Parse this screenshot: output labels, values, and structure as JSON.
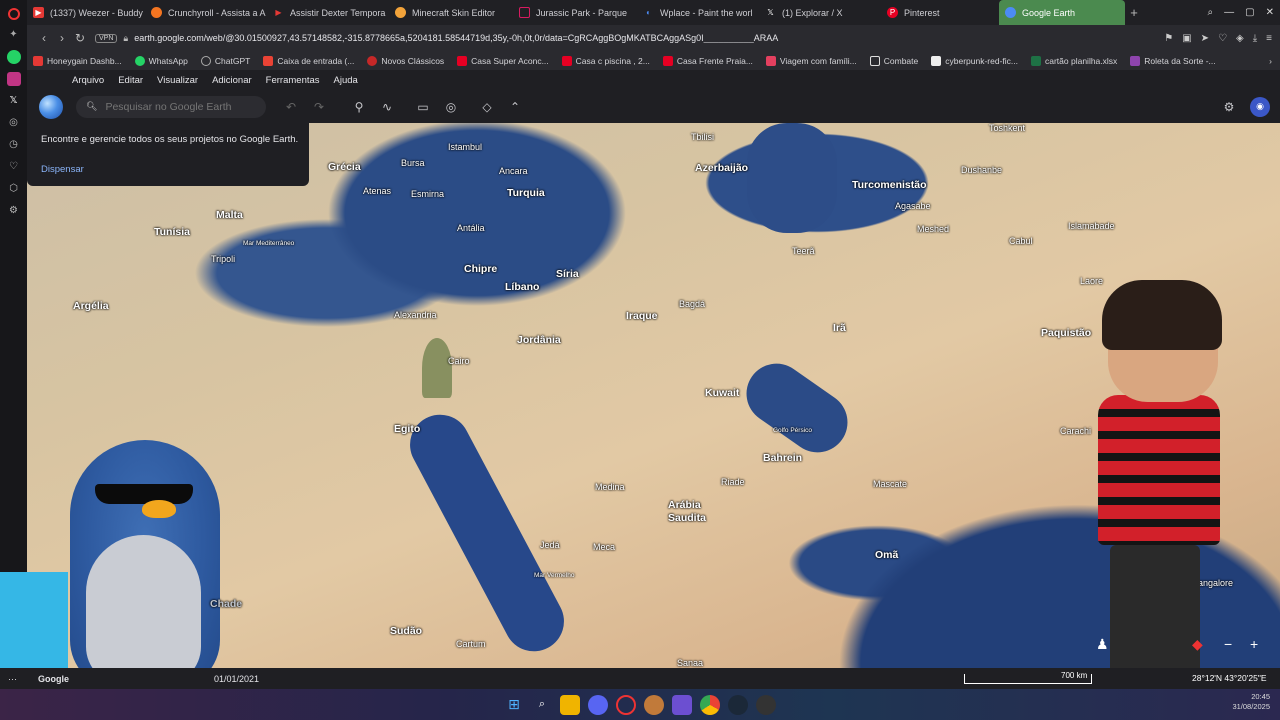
{
  "browser": {
    "tabs": [
      {
        "label": "(1337) Weezer - Buddy H",
        "color": "#e53935"
      },
      {
        "label": "Crunchyroll - Assista a A",
        "color": "#f47521"
      },
      {
        "label": "Assistir Dexter Tempora",
        "color": "#e53935"
      },
      {
        "label": "Minecraft Skin Editor",
        "color": "#f2a33a"
      },
      {
        "label": "Jurassic Park - Parque",
        "color": "#d81b60"
      },
      {
        "label": "Wplace - Paint the worl",
        "color": "#4c8bf5"
      },
      {
        "label": "(1) Explorar / X",
        "color": "#222222"
      },
      {
        "label": "Pinterest",
        "color": "#e60023"
      },
      {
        "label": "Google Earth",
        "color": "#4c8bf5"
      }
    ],
    "url": "earth.google.com/web/@30.01500927,43.57148582,-315.8778665a,5204181.58544719d,35y,-0h,0t,0r/data=CgRCAggBOgMKATBCAggASg0I__________ARAA",
    "vpn_label": "VPN",
    "bookmarks": [
      {
        "label": "Honeygain Dashb...",
        "color": "#e53935"
      },
      {
        "label": "WhatsApp",
        "color": "#25d366"
      },
      {
        "label": "ChatGPT",
        "color": "#aaaaaa"
      },
      {
        "label": "Caixa de entrada (...",
        "color": "#ea4335"
      },
      {
        "label": "Novos Clássicos",
        "color": "#c62828"
      },
      {
        "label": "Casa Super Aconc...",
        "color": "#e60023"
      },
      {
        "label": "Casa c piscina , 2...",
        "color": "#e60023"
      },
      {
        "label": "Casa Frente Praia...",
        "color": "#e60023"
      },
      {
        "label": "Viagem com famíli...",
        "color": "#e4405f"
      },
      {
        "label": "Combate",
        "color": "#dddddd"
      },
      {
        "label": "cyberpunk-red-fic...",
        "color": "#eeeeee"
      },
      {
        "label": "cartão planilha.xlsx",
        "color": "#1e7145"
      },
      {
        "label": "Roleta da Sorte -...",
        "color": "#8e44ad"
      }
    ]
  },
  "earth": {
    "menu": [
      "Arquivo",
      "Editar",
      "Visualizar",
      "Adicionar",
      "Ferramentas",
      "Ajuda"
    ],
    "search_placeholder": "Pesquisar no Google Earth",
    "popup_text": "Encontre e gerencie todos os seus projetos no Google Earth.",
    "popup_button": "Dispensar",
    "status_logo": "Google",
    "date": "01/01/2021",
    "scale": "700 km",
    "coords": "28°12'N 43°20'25\"E",
    "watermark": "Chade"
  },
  "map_labels": {
    "grecia": "Grécia",
    "istambul": "Istambul",
    "burca": "Bursa",
    "ancara": "Ancara",
    "tbilisi": "Tbilisi",
    "azerbaijao": "Azerbaijão",
    "turquia": "Turquia",
    "atenas": "Atenas",
    "esmirna": "Esmirna",
    "turcomenistao": "Turcomenistão",
    "dushanbe": "Dushanbe",
    "toshkent": "Toshkent",
    "malta": "Malta",
    "tunisia": "Tunísia",
    "antalia": "Antália",
    "agasabe": "Agasabe",
    "mashhad": "Meshed",
    "tripoli": "Tripoli",
    "chipre": "Chipre",
    "siria": "Síria",
    "teera": "Teerã",
    "cabul": "Cabul",
    "islamabade": "Islamabade",
    "libano": "Líbano",
    "iraque": "Iraque",
    "bagda": "Bagdá",
    "argelia": "Argélia",
    "alexandria": "Alexandria",
    "jordania": "Jordânia",
    "ira": "Irã",
    "laore": "Laore",
    "paquistao": "Paquistão",
    "cairo": "Cairo",
    "kuwait": "Kuwait",
    "egito": "Egito",
    "golfo": "Golfo Pérsico",
    "bahrein": "Bahrein",
    "carachi": "Carachi",
    "medina": "Medina",
    "riade": "Riade",
    "mascate": "Mascate",
    "arabia": "Arábia",
    "saudita": "Saudita",
    "jeda": "Jedá",
    "meca": "Meca",
    "oma": "Omã",
    "sudao": "Sudão",
    "cartum": "Cartum",
    "sanaa": "Sanaa",
    "bangalore": "Bangalore",
    "mar_mediterraneo": "Mar Mediterrâneo",
    "mar_vermelho": "Mar Vermelho"
  },
  "taskbar": {
    "time": "20:45",
    "date": "31/08/2025"
  }
}
